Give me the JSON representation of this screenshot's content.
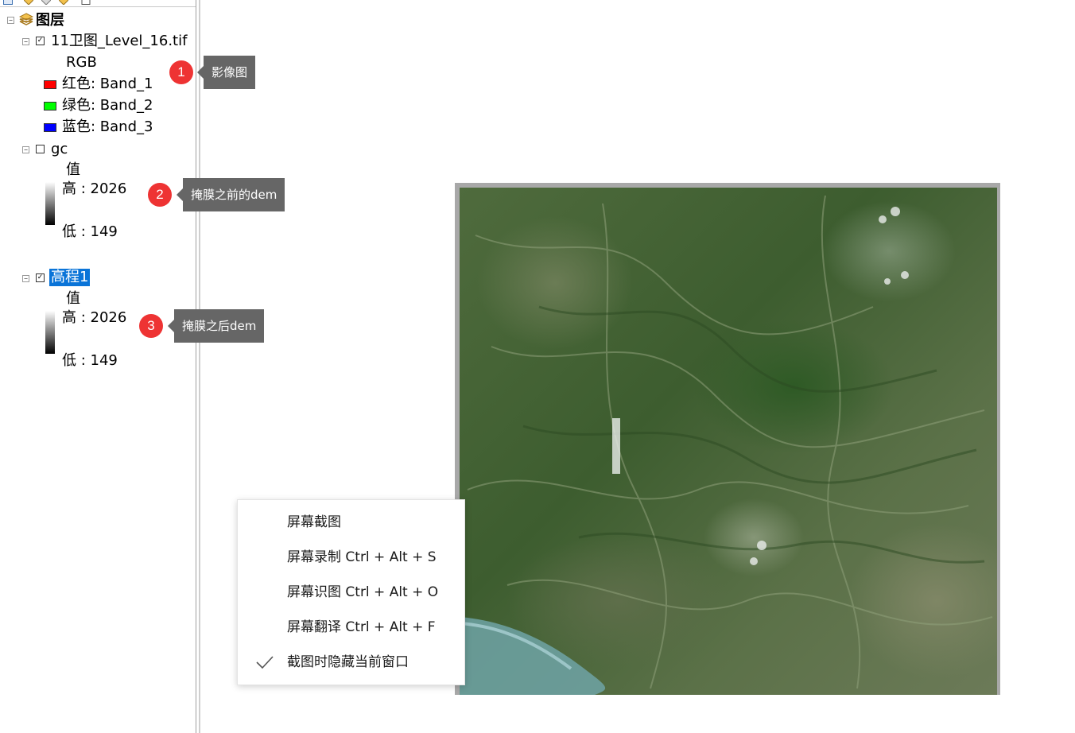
{
  "toc": {
    "root_label": "图层",
    "layer1": {
      "name": "11卫图_Level_16.tif",
      "checked": "☑",
      "expander": "−",
      "render_label": "RGB",
      "bands": [
        {
          "label": "红色:   Band_1",
          "color": "#ff0000"
        },
        {
          "label": "绿色: Band_2",
          "color": "#00ff00"
        },
        {
          "label": "蓝色:   Band_3",
          "color": "#0000ff"
        }
      ]
    },
    "layer2": {
      "name": "gc",
      "expander": "−",
      "value_label": "值",
      "high": "高 : 2026",
      "low": "低 : 149"
    },
    "layer3": {
      "name": "高程1",
      "expander": "−",
      "value_label": "值",
      "high": "高 : 2026",
      "low": "低 : 149"
    }
  },
  "callouts": [
    {
      "number": "1",
      "text": "影像图"
    },
    {
      "number": "2",
      "text": "掩膜之前的dem"
    },
    {
      "number": "3",
      "text": "掩膜之后dem"
    }
  ],
  "context_menu": {
    "items": [
      {
        "label": "屏幕截图"
      },
      {
        "label": "屏幕录制 Ctrl + Alt + S"
      },
      {
        "label": "屏幕识图 Ctrl + Alt + O"
      },
      {
        "label": "屏幕翻译 Ctrl + Alt + F"
      },
      {
        "label": "截图时隐藏当前窗口",
        "checked": true
      }
    ]
  },
  "colors": {
    "selection": "#0a74d8",
    "badge": "#ee3333",
    "callout_bg": "#666666"
  }
}
